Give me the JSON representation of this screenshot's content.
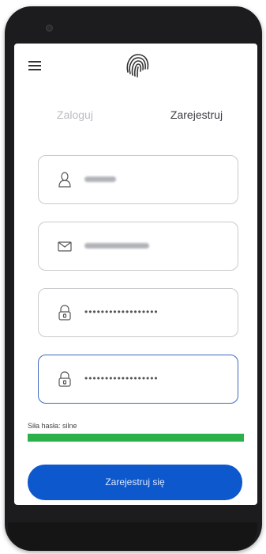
{
  "app": {
    "brand_color": "#0d58cc",
    "accent_color": "#3f6fd1"
  },
  "header": {
    "menu_icon": "hamburger-icon",
    "logo_icon": "fingerprint-icon"
  },
  "tabs": [
    {
      "label": "Zaloguj",
      "active": false
    },
    {
      "label": "Zarejestruj",
      "active": true
    }
  ],
  "form": {
    "fields": [
      {
        "name": "username",
        "icon": "user-icon",
        "value_obscured": true
      },
      {
        "name": "email",
        "icon": "envelope-icon",
        "value_obscured": true
      },
      {
        "name": "password",
        "icon": "padlock-icon",
        "value": "••••••••••••••••••"
      },
      {
        "name": "password_confirm",
        "icon": "padlock-icon",
        "value": "••••••••••••••••••",
        "focused": true
      }
    ],
    "strength_label": "Siła hasła: silne",
    "strength_level": 1.0,
    "strength_color": "#2bb04a",
    "submit_label": "Zarejestruj się"
  }
}
